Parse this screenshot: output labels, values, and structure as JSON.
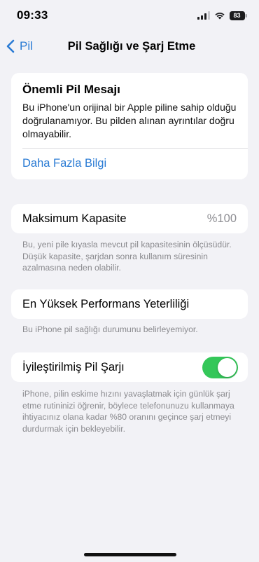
{
  "status_bar": {
    "time": "09:33",
    "battery_level": "83",
    "icons": [
      "signal-icon",
      "wifi-icon",
      "battery-icon"
    ]
  },
  "nav": {
    "back_label": "Pil",
    "title": "Pil Sağlığı ve Şarj Etme"
  },
  "message": {
    "title": "Önemli Pil Mesajı",
    "body": "Bu iPhone'un orijinal bir Apple piline sahip olduğu doğrulanamıyor. Bu pilden alınan ayrıntılar doğru olmayabilir.",
    "link": "Daha Fazla Bilgi"
  },
  "capacity": {
    "label": "Maksimum Kapasite",
    "value": "%100",
    "footnote": "Bu, yeni pile kıyasla mevcut pil kapasitesinin ölçüsüdür. Düşük kapasite, şarjdan sonra kullanım süresinin azalmasına neden olabilir."
  },
  "performance": {
    "label": "En Yüksek Performans Yeterliliği",
    "footnote": "Bu iPhone pil sağlığı durumunu belirleyemiyor."
  },
  "optimized_charging": {
    "label": "İyileştirilmiş Pil Şarjı",
    "enabled": true,
    "footnote": "iPhone, pilin eskime hızını yavaşlatmak için günlük şarj etme rutininizi öğrenir, böylece telefonunuzu kullanmaya ihtiyacınız olana kadar %80 oranını geçince şarj etmeyi durdurmak için bekleyebilir."
  },
  "colors": {
    "accent": "#2a7bd4",
    "toggle_on": "#34c759",
    "background": "#f2f2f6"
  }
}
